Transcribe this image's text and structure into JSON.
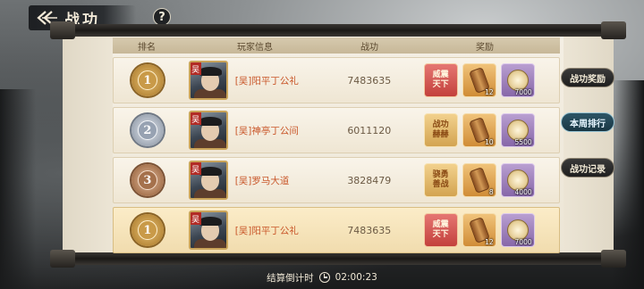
{
  "header": {
    "title": "战功",
    "back_icon": "back-arrow-icon",
    "help_label": "?"
  },
  "columns": [
    "排名",
    "玩家信息",
    "战功",
    "奖励"
  ],
  "rows": [
    {
      "rank": "1",
      "medal": "gold",
      "faction": "吴",
      "name": "[吴]阳平丁公礼",
      "score": "7483635",
      "rewards": [
        {
          "type": "title",
          "style": "title-red",
          "text": "威震天下",
          "qty": ""
        },
        {
          "type": "item",
          "style": "item-orange",
          "icon": "scroll-icon",
          "qty": "12"
        },
        {
          "type": "item",
          "style": "item-purple",
          "icon": "coin-icon",
          "qty": "7000"
        }
      ]
    },
    {
      "rank": "2",
      "medal": "silver",
      "faction": "吴",
      "name": "[吴]神亭丁公间",
      "score": "6011120",
      "rewards": [
        {
          "type": "title",
          "style": "title-gold",
          "text": "战功赫赫",
          "qty": ""
        },
        {
          "type": "item",
          "style": "item-orange",
          "icon": "scroll-icon",
          "qty": "10"
        },
        {
          "type": "item",
          "style": "item-purple",
          "icon": "coin-icon",
          "qty": "5500"
        }
      ]
    },
    {
      "rank": "3",
      "medal": "bronze",
      "faction": "吴",
      "name": "[吴]罗马大道",
      "score": "3828479",
      "rewards": [
        {
          "type": "title",
          "style": "title-gold",
          "text": "骁勇善战",
          "qty": ""
        },
        {
          "type": "item",
          "style": "item-orange",
          "icon": "scroll-icon",
          "qty": "8"
        },
        {
          "type": "item",
          "style": "item-purple",
          "icon": "coin-icon",
          "qty": "4000"
        }
      ]
    }
  ],
  "my_row": {
    "rank": "1",
    "medal": "gold",
    "faction": "吴",
    "name": "[吴]阳平丁公礼",
    "score": "7483635",
    "rewards": [
      {
        "type": "title",
        "style": "title-red",
        "text": "威震天下",
        "qty": ""
      },
      {
        "type": "item",
        "style": "item-orange",
        "icon": "scroll-icon",
        "qty": "12"
      },
      {
        "type": "item",
        "style": "item-purple",
        "icon": "coin-icon",
        "qty": "7000"
      }
    ]
  },
  "side_tabs": [
    {
      "label": "战功奖励",
      "active": false
    },
    {
      "label": "本周排行",
      "active": true
    },
    {
      "label": "战功记录",
      "active": false
    }
  ],
  "footer": {
    "countdown_label": "结算倒计时",
    "countdown_value": "02:00:23",
    "clock_icon": "clock-icon"
  },
  "colors": {
    "accent_red": "#c3413c",
    "name_orange": "#c9572a",
    "active_tab": "#2c5566"
  }
}
